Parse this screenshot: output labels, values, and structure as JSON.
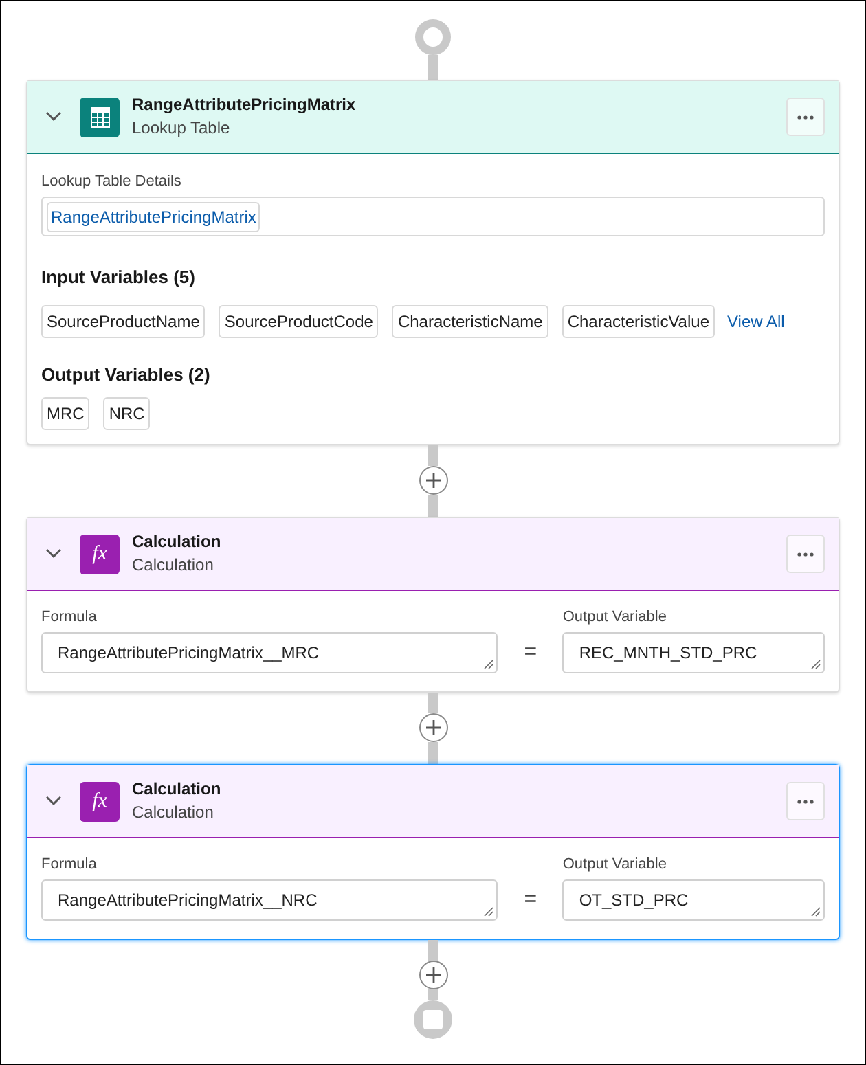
{
  "cards": [
    {
      "kind": "lookup_table",
      "title": "RangeAttributePricingMatrix",
      "subtitle": "Lookup Table",
      "expanded": true,
      "selected": false,
      "details_label": "Lookup Table Details",
      "details_value": "RangeAttributePricingMatrix",
      "input_heading": "Input Variables (5)",
      "inputs": [
        "SourceProductName",
        "SourceProductCode",
        "CharacteristicName",
        "CharacteristicValue"
      ],
      "view_all": "View All",
      "output_heading": "Output Variables (2)",
      "outputs": [
        "MRC",
        "NRC"
      ]
    },
    {
      "kind": "calculation",
      "title": "Calculation",
      "subtitle": "Calculation",
      "icon_glyph": "fx",
      "expanded": true,
      "selected": false,
      "formula_label": "Formula",
      "formula": "RangeAttributePricingMatrix__MRC",
      "equals": "=",
      "output_label": "Output Variable",
      "output": "REC_MNTH_STD_PRC"
    },
    {
      "kind": "calculation",
      "title": "Calculation",
      "subtitle": "Calculation",
      "icon_glyph": "fx",
      "expanded": true,
      "selected": true,
      "formula_label": "Formula",
      "formula": "RangeAttributePricingMatrix__NRC",
      "equals": "=",
      "output_label": "Output Variable",
      "output": "OT_STD_PRC"
    }
  ]
}
